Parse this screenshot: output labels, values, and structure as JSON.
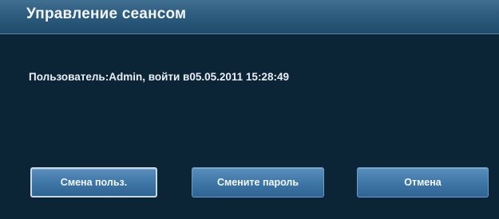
{
  "dialog": {
    "title": "Управление сеансом",
    "session_info": "Пользователь:Admin, войти в05.05.2011 15:28:49"
  },
  "buttons": {
    "switch_user": "Смена польз.",
    "change_password": "Смените пароль",
    "cancel": "Отмена"
  },
  "colors": {
    "background": "#0b2537",
    "titlebar": "#2d5c7e",
    "button": "#3f77a7",
    "text": "#e8eef3"
  }
}
